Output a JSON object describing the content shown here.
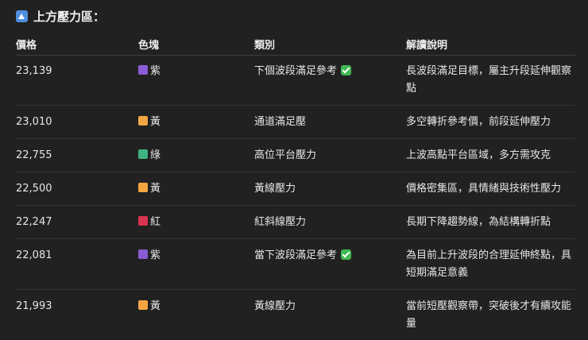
{
  "heading": {
    "icon": "up-arrow-icon",
    "text": "上方壓力區："
  },
  "table": {
    "headers": [
      "價格",
      "色塊",
      "類別",
      "解讀說明"
    ],
    "rows": [
      {
        "price": "23,139",
        "color_label": "紫",
        "color_hex": "#8a5cd6",
        "category": "下個波段滿足參考",
        "checked": true,
        "description": "長波段滿足目標，屬主升段延伸觀察點"
      },
      {
        "price": "23,010",
        "color_label": "黃",
        "color_hex": "#f2a541",
        "category": "通道滿足壓",
        "checked": false,
        "description": "多空轉折參考價，前段延伸壓力"
      },
      {
        "price": "22,755",
        "color_label": "綠",
        "color_hex": "#3fb27f",
        "category": "高位平台壓力",
        "checked": false,
        "description": "上波高點平台區域，多方需攻克"
      },
      {
        "price": "22,500",
        "color_label": "黃",
        "color_hex": "#f2a541",
        "category": "黃線壓力",
        "checked": false,
        "description": "價格密集區，具情緒與技術性壓力"
      },
      {
        "price": "22,247",
        "color_label": "紅",
        "color_hex": "#d9344f",
        "category": "紅斜線壓力",
        "checked": false,
        "description": "長期下降趨勢線，為結構轉折點"
      },
      {
        "price": "22,081",
        "color_label": "紫",
        "color_hex": "#8a5cd6",
        "category": "當下波段滿足參考",
        "checked": true,
        "description": "為目前上升波段的合理延伸終點，具短期滿足意義"
      },
      {
        "price": "21,993",
        "color_label": "黃",
        "color_hex": "#f2a541",
        "category": "黃線壓力",
        "checked": false,
        "description": "當前短壓觀察帶，突破後才有續攻能量"
      }
    ]
  }
}
